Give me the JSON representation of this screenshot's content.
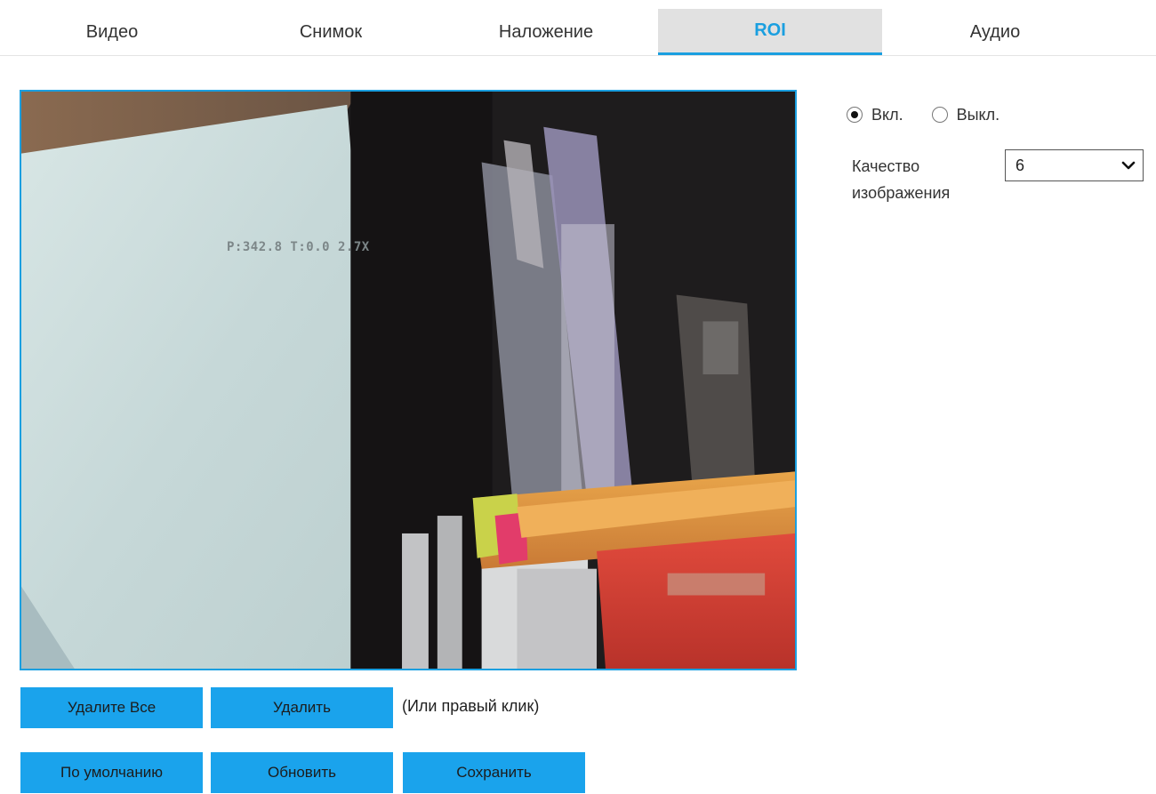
{
  "tabs": [
    {
      "label": "Видео",
      "active": false
    },
    {
      "label": "Снимок",
      "active": false
    },
    {
      "label": "Наложение",
      "active": false
    },
    {
      "label": "ROI",
      "active": true
    },
    {
      "label": "Аудио",
      "active": false
    }
  ],
  "video": {
    "osd_text": "P:342.8 T:0.0 2.7X"
  },
  "roi": {
    "enable_options": [
      {
        "label": "Вкл.",
        "checked": true
      },
      {
        "label": "Выкл.",
        "checked": false
      }
    ],
    "quality": {
      "label": "Качество изображения",
      "value": "6"
    }
  },
  "buttons": {
    "delete_all": "Удалите Все",
    "delete": "Удалить",
    "delete_hint": "(Или правый клик)",
    "default": "По умолчанию",
    "refresh": "Обновить",
    "save": "Сохранить"
  },
  "colors": {
    "accent": "#1a9fe0",
    "button": "#1aa3ec",
    "active_tab_bg": "#e1e1e1"
  }
}
